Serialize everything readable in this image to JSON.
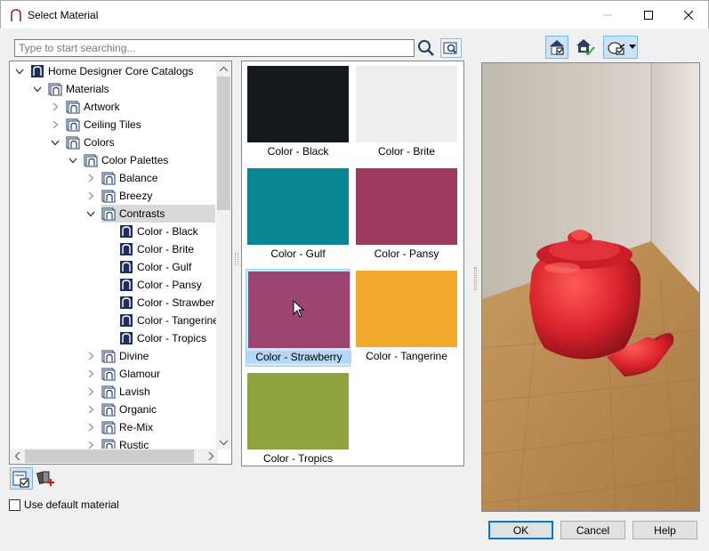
{
  "window": {
    "title": "Select Material"
  },
  "search": {
    "placeholder": "Type to start searching..."
  },
  "tree": {
    "rows": [
      {
        "label": "Home Designer Core Catalogs",
        "level": 0,
        "expanded": true,
        "icon": "catalog-icon"
      },
      {
        "label": "Materials",
        "level": 1,
        "expanded": true,
        "icon": "folder-icon"
      },
      {
        "label": "Artwork",
        "level": 2,
        "expanded": false,
        "icon": "folder-icon"
      },
      {
        "label": "Ceiling Tiles",
        "level": 2,
        "expanded": false,
        "icon": "folder-icon"
      },
      {
        "label": "Colors",
        "level": 2,
        "expanded": true,
        "icon": "folder-icon"
      },
      {
        "label": "Color Palettes",
        "level": 3,
        "expanded": true,
        "icon": "folder-icon"
      },
      {
        "label": "Balance",
        "level": 4,
        "expanded": false,
        "icon": "folder-icon"
      },
      {
        "label": "Breezy",
        "level": 4,
        "expanded": false,
        "icon": "folder-icon"
      },
      {
        "label": "Contrasts",
        "level": 4,
        "expanded": true,
        "icon": "folder-icon",
        "selected": true
      },
      {
        "label": "Color - Black",
        "level": 5,
        "icon": "material-icon"
      },
      {
        "label": "Color - Brite",
        "level": 5,
        "icon": "material-icon"
      },
      {
        "label": "Color - Gulf",
        "level": 5,
        "icon": "material-icon"
      },
      {
        "label": "Color - Pansy",
        "level": 5,
        "icon": "material-icon"
      },
      {
        "label": "Color - Strawber",
        "level": 5,
        "icon": "material-icon"
      },
      {
        "label": "Color - Tangerine",
        "level": 5,
        "icon": "material-icon"
      },
      {
        "label": "Color - Tropics",
        "level": 5,
        "icon": "material-icon"
      },
      {
        "label": "Divine",
        "level": 4,
        "expanded": false,
        "icon": "folder-icon"
      },
      {
        "label": "Glamour",
        "level": 4,
        "expanded": false,
        "icon": "folder-icon"
      },
      {
        "label": "Lavish",
        "level": 4,
        "expanded": false,
        "icon": "folder-icon"
      },
      {
        "label": "Organic",
        "level": 4,
        "expanded": false,
        "icon": "folder-icon"
      },
      {
        "label": "Re-Mix",
        "level": 4,
        "expanded": false,
        "icon": "folder-icon"
      },
      {
        "label": "Rustic",
        "level": 4,
        "expanded": false,
        "icon": "folder-icon"
      }
    ]
  },
  "swatches": [
    {
      "label": "Color - Black",
      "color": "#16191c"
    },
    {
      "label": "Color - Brite",
      "color": "#eeeeee"
    },
    {
      "label": "Color - Gulf",
      "color": "#0a8593"
    },
    {
      "label": "Color - Pansy",
      "color": "#a03960"
    },
    {
      "label": "Color - Strawberry",
      "color": "#9c4570",
      "selected": true
    },
    {
      "label": "Color - Tangerine",
      "color": "#f4a82b"
    },
    {
      "label": "Color - Tropics",
      "color": "#8fa33f"
    }
  ],
  "options": {
    "use_default_label": "Use default material",
    "use_default_checked": false
  },
  "buttons": {
    "ok": "OK",
    "cancel": "Cancel",
    "help": "Help"
  },
  "colors": {
    "accent": "#0078d7",
    "selection": "#cce8ff",
    "teapot": "#d8222c"
  }
}
